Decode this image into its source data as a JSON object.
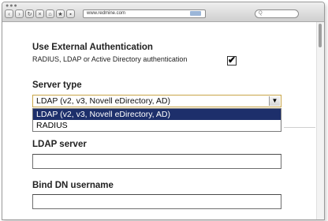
{
  "browser": {
    "url": "www.redmine.com",
    "search_placeholder": "Q",
    "nav_icons": [
      "back-icon",
      "forward-icon",
      "reload-icon",
      "stop-icon",
      "home-icon",
      "bookmark-icon",
      "lock-icon"
    ]
  },
  "auth": {
    "title": "Use External Authentication",
    "description": "RADIUS, LDAP or Active Directory authentication",
    "checked": true,
    "check_glyph": "✔"
  },
  "server_type": {
    "label": "Server type",
    "selected": "LDAP (v2, v3, Novell eDirectory, AD)",
    "arrow": "▼",
    "options": [
      "LDAP (v2, v3, Novell eDirectory, AD)",
      "RADIUS"
    ]
  },
  "ldap_server": {
    "label": "LDAP server",
    "value": ""
  },
  "bind_dn": {
    "label": "Bind DN username",
    "value": ""
  }
}
